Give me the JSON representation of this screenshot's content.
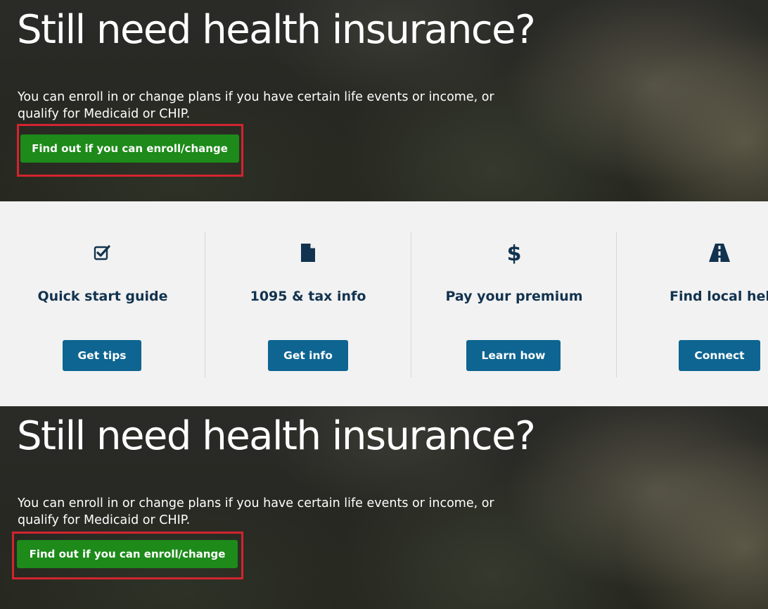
{
  "hero_top": {
    "title": "Still need health insurance?",
    "description": "You can enroll in or change plans if you have certain life events or income, or qualify for Medicaid or CHIP.",
    "button_label": "Find out if you can enroll/change"
  },
  "cards": [
    {
      "icon": "checkbox-icon",
      "title": "Quick start guide",
      "button_label": "Get tips"
    },
    {
      "icon": "document-icon",
      "title": "1095 & tax info",
      "button_label": "Get info"
    },
    {
      "icon": "dollar-icon",
      "title": "Pay your premium",
      "button_label": "Learn how"
    },
    {
      "icon": "road-icon",
      "title": "Find local help",
      "button_label": "Connect"
    }
  ],
  "hero_bottom": {
    "title": "Still need health insurance?",
    "description": "You can enroll in or change plans if you have certain life events or income, or qualify for Medicaid or CHIP.",
    "button_label": "Find out if you can enroll/change"
  },
  "colors": {
    "enroll_button": "#1d8a1a",
    "card_button": "#0e6591",
    "card_title": "#12334f",
    "highlight": "#d3242f"
  }
}
